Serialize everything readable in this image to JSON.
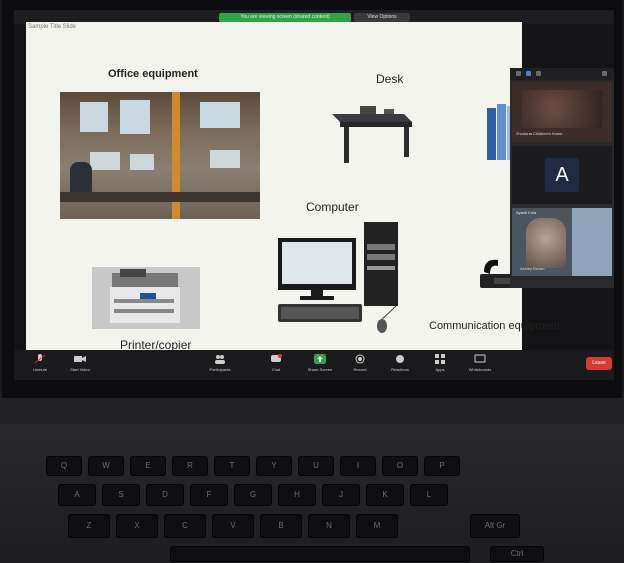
{
  "zoom": {
    "share_banner": "You are viewing screen (shared content)",
    "view_options": "View Options"
  },
  "slide": {
    "header": "Sample Title Slide",
    "labels": {
      "office_equipment": "Office equipment",
      "desk": "Desk",
      "computer": "Computer",
      "printer_copier": "Printer/copier",
      "communication_equipment": "Communication equipment"
    }
  },
  "participants_panel": {
    "tile1_name": "Zhudana Children's Home",
    "tile2_avatar": "A",
    "tile3_name": "Ayanti Kola",
    "tile3_sub": "Ashley Brown"
  },
  "toolbar": {
    "items": [
      "Unmute",
      "Start Video",
      "Participants",
      "Chat",
      "Share Screen",
      "Record",
      "Reactions",
      "Apps",
      "Whiteboards"
    ],
    "end": "Leave"
  },
  "keyboard": {
    "row1": [
      "Q",
      "W",
      "E",
      "R",
      "T",
      "Y",
      "U",
      "I",
      "O",
      "P"
    ],
    "row2": [
      "A",
      "S",
      "D",
      "F",
      "G",
      "H",
      "J",
      "K",
      "L"
    ],
    "row3": [
      "Z",
      "X",
      "C",
      "V",
      "B",
      "N",
      "M"
    ],
    "alt": "Alt Gr",
    "ctrl": "Ctrl"
  }
}
